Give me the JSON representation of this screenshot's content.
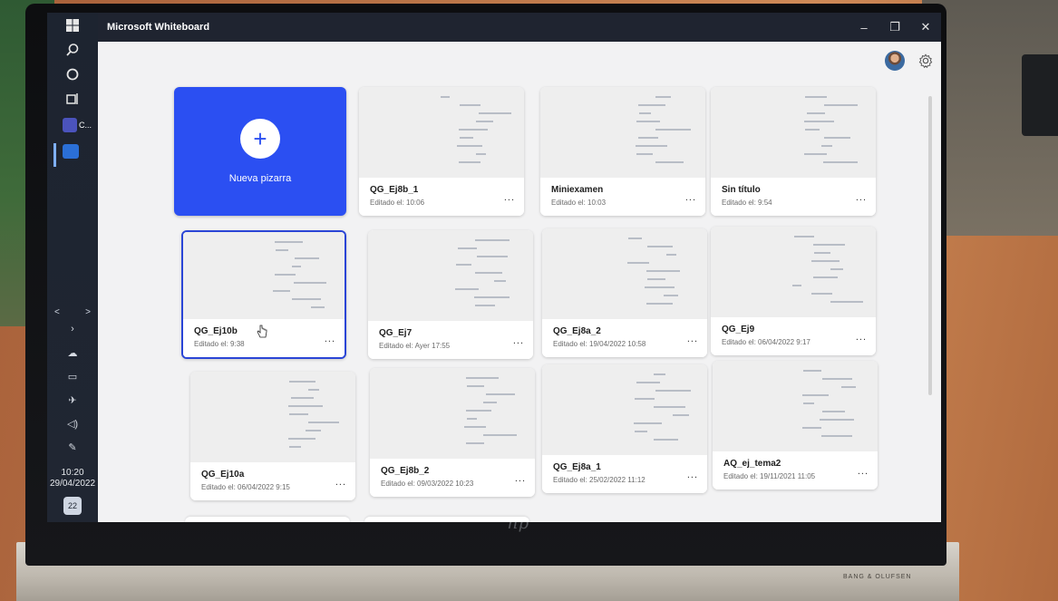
{
  "window": {
    "title": "Microsoft Whiteboard",
    "controls": {
      "minimize": "–",
      "restore": "❐",
      "close": "✕"
    }
  },
  "taskbar": {
    "apps": [
      {
        "name": "teams",
        "label": "C...",
        "color": "#4b53bc"
      },
      {
        "name": "whiteboard",
        "label": "",
        "color": "#2b6fd6"
      }
    ],
    "chevrons": {
      "left": "<",
      "right": ">"
    },
    "clock": {
      "time": "10:20",
      "date": "29/04/2022"
    },
    "notifications": "22"
  },
  "new_board": {
    "label": "Nueva pizarra"
  },
  "boards": [
    {
      "name": "QG_Ej8b_1",
      "edited": "Editado el: 10:06",
      "selected": false
    },
    {
      "name": "Miniexamen",
      "edited": "Editado el: 10:03",
      "selected": false
    },
    {
      "name": "Sin título",
      "edited": "Editado el: 9:54",
      "selected": false
    },
    {
      "name": "QG_Ej10b",
      "edited": "Editado el: 9:38",
      "selected": true
    },
    {
      "name": "QG_Ej7",
      "edited": "Editado el: Ayer 17:55",
      "selected": false
    },
    {
      "name": "QG_Ej8a_2",
      "edited": "Editado el: 19/04/2022 10:58",
      "selected": false
    },
    {
      "name": "QG_Ej9",
      "edited": "Editado el: 06/04/2022 9:17",
      "selected": false
    },
    {
      "name": "QG_Ej10a",
      "edited": "Editado el: 06/04/2022 9:15",
      "selected": false
    },
    {
      "name": "QG_Ej8b_2",
      "edited": "Editado el: 09/03/2022 10:23",
      "selected": false
    },
    {
      "name": "QG_Ej8a_1",
      "edited": "Editado el: 25/02/2022 11:12",
      "selected": false
    },
    {
      "name": "AQ_ej_tema2",
      "edited": "Editado el: 19/11/2021 11:05",
      "selected": false
    }
  ],
  "more_label": "...",
  "hardware": {
    "brand": "hp",
    "speaker": "BANG & OLUFSEN"
  },
  "colors": {
    "accent": "#2b4ff2",
    "selected_border": "#2a45d6",
    "titlebar": "#1f2430"
  }
}
